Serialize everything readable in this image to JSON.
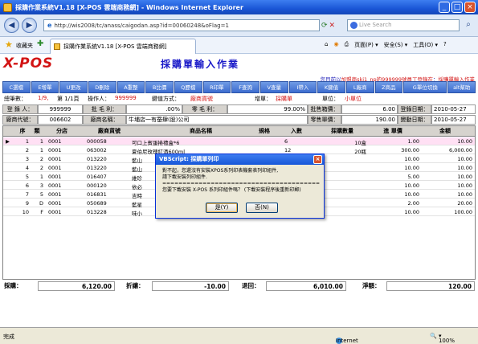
{
  "window": {
    "title": "採購作業系統V1.18 [X-POS 雲端商務網] - Windows Internet Explorer",
    "minimize": "_",
    "maximize": "□",
    "close": "×"
  },
  "browser": {
    "back_icon": "◀",
    "forward_icon": "▶",
    "address": "http://wis2008/tc/anass/caigodan.asp?id=00060248&oFlag=1",
    "search_placeholder": "Live Search",
    "search_icon": "⌕",
    "favorites_label": "收藏夹",
    "tab_title": "採購作業系統V1.18 [X-POS 雲端商務網]",
    "tools": [
      "页面(P) ▾",
      "安全(S) ▾",
      "工具(O) ▾"
    ],
    "help_icon": "?"
  },
  "app": {
    "logo": "X-POS",
    "heading": "採購單輸入作業",
    "notice_prefix": "您目前以",
    "notice_user": "加盟商ski1_np的999999號員工登錄在",
    "notice_suffix": "：",
    "notice_location": "採購單輸入作業",
    "fkeys": [
      "C選檔",
      "E增單",
      "U更改",
      "D刪除",
      "A重整",
      "B比價",
      "Q歷檔",
      "R印單",
      "F查詢",
      "V查量",
      "I帶入",
      "K鍵值",
      "L廠商",
      "Z商品",
      "G單位切換",
      "alt幫助"
    ]
  },
  "info": {
    "total_label": "總筆數：",
    "total_value": "1/9,",
    "page_label": "第 1/1頁",
    "operator_label": "操作人：",
    "operator_value": "999999",
    "keymode_label": "鍵值方式：",
    "keymode_value": "廠商貨號",
    "add_label": "增單：",
    "add_value": "採購單",
    "unit_label": "單位：",
    "unit_value": "小單位"
  },
  "form": {
    "entry_label": "登 錄 人：",
    "entry_value": "999999",
    "margin_label": "批 毛 利：",
    "margin_value": ".00%",
    "retail_margin_label": "零 毛 利：",
    "retail_margin_value": "99.00%",
    "wholesale_box_label": "批售箱價：",
    "wholesale_box_value": "6.00",
    "entry_date_label": "登錄日期：",
    "entry_date_value": "2010-05-27",
    "vendor_code_label": "廠商代號：",
    "vendor_code_value": "006602",
    "vendor_name_label": "廠商名稱：",
    "vendor_name_value": "牛埔店一有蚕肆(股)公司",
    "retail_price_label": "零售單價：",
    "retail_price_value": "190.00",
    "change_date_label": "變動日期：",
    "change_date_value": "2010-05-27"
  },
  "table": {
    "headers": [
      "序",
      "類",
      "分店",
      "廠商貨號",
      "商品名稱",
      "規格",
      "入數",
      "採購數量",
      "進 單價",
      "金額"
    ],
    "rows": [
      {
        "seq": "1",
        "cls": "1",
        "store": "0001",
        "code": "000058",
        "name": "可口上賓蛋捲禮盒*6",
        "spec": "",
        "qty": "6",
        "order": "10盒",
        "price": "1.00",
        "amount": "10.00"
      },
      {
        "seq": "2",
        "cls": "1",
        "store": "0001",
        "code": "063002",
        "name": "夏伯尼玫瑰紅酒600ml",
        "spec": "",
        "qty": "12",
        "order": "20瓶",
        "price": "300.00",
        "amount": "6,000.00"
      },
      {
        "seq": "3",
        "cls": "2",
        "store": "0001",
        "code": "013220",
        "name": "藍山",
        "spec": "",
        "qty": "",
        "order": "",
        "price": "10.00",
        "amount": "10.00"
      },
      {
        "seq": "4",
        "cls": "2",
        "store": "0001",
        "code": "013220",
        "name": "藍山",
        "spec": "",
        "qty": "",
        "order": "",
        "price": "10.00",
        "amount": "10.00"
      },
      {
        "seq": "5",
        "cls": "1",
        "store": "0001",
        "code": "016407",
        "name": "維珍",
        "spec": "",
        "qty": "",
        "order": "",
        "price": "5.00",
        "amount": "10.00"
      },
      {
        "seq": "6",
        "cls": "3",
        "store": "0001",
        "code": "000120",
        "name": "依必",
        "spec": "",
        "qty": "",
        "order": "",
        "price": "10.00",
        "amount": "10.00"
      },
      {
        "seq": "7",
        "cls": "5",
        "store": "0001",
        "code": "016831",
        "name": "吉時",
        "spec": "",
        "qty": "",
        "order": "",
        "price": "10.00",
        "amount": "10.00"
      },
      {
        "seq": "9",
        "cls": "D",
        "store": "0001",
        "code": "050689",
        "name": "藍星",
        "spec": "",
        "qty": "",
        "order": "",
        "price": "2.00",
        "amount": "20.00"
      },
      {
        "seq": "10",
        "cls": "F",
        "store": "0001",
        "code": "013228",
        "name": "味小",
        "spec": "",
        "qty": "",
        "order": "",
        "price": "10.00",
        "amount": "100.00"
      }
    ]
  },
  "totals": {
    "purchase_label": "採購：",
    "purchase_value": "6,120.00",
    "discount_label": "折讓：",
    "discount_value": "-10.00",
    "return_label": "退回：",
    "return_value": "6,010.00",
    "net_label": "淨額：",
    "net_value": "120.00"
  },
  "dialog": {
    "title": "VBScript: 採購單列印",
    "close": "×",
    "line1": "對不起，您還沒有安裝XPOS系列印表機套表列印組件,",
    "line2": "請下載安裝列印組件.",
    "line3": "=================================================",
    "line4": "您要下載安裝 X-POS 系列印組件嗎？ (下載安裝程序後重新印郵)",
    "yes_label": "是(Y)",
    "no_label": "否(N)"
  },
  "status": {
    "left": "完成",
    "zone": "Internet",
    "zoom": "100%"
  }
}
